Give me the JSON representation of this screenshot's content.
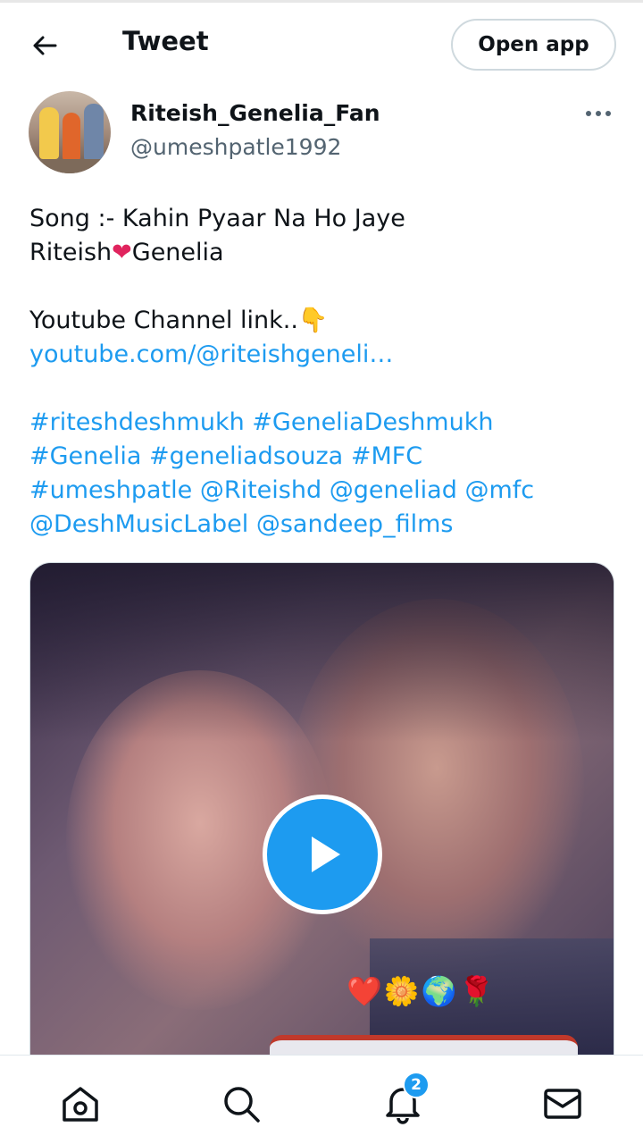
{
  "header": {
    "title": "Tweet",
    "open_app_label": "Open app"
  },
  "author": {
    "display_name": "Riteish_Genelia_Fan",
    "handle": "@umeshpatle1992"
  },
  "tweet": {
    "line1": "Song :- Kahin Pyaar Na Ho Jaye",
    "line2_a": "Riteish",
    "line2_heart": "❤",
    "line2_b": "Genelia",
    "line3": "Youtube Channel link..",
    "line3_emoji": "👇",
    "link": "youtube.com/@riteishgeneli…",
    "tags": {
      "t1": "#riteshdeshmukh",
      "t2": "#GeneliaDeshmukh",
      "t3": "#Genelia",
      "t4": "#geneliadsouza",
      "t5": "#MFC",
      "t6": "#umeshpatle",
      "m1": "@Riteishd",
      "m2": "@geneliad",
      "m3": "@mfc",
      "m4": "@DeshMusicLabel",
      "m5": "@sandeep_films"
    }
  },
  "media": {
    "overlay_emojis": "❤️🌼🌍🌹"
  },
  "bottom_nav": {
    "notification_count": "2"
  },
  "colors": {
    "link": "#1d9bf0",
    "text": "#0f1419",
    "secondary": "#536471",
    "border": "#cfd9de"
  },
  "icons": [
    "back-arrow-icon",
    "more-icon",
    "play-icon",
    "home-icon",
    "search-icon",
    "bell-icon",
    "mail-icon"
  ]
}
